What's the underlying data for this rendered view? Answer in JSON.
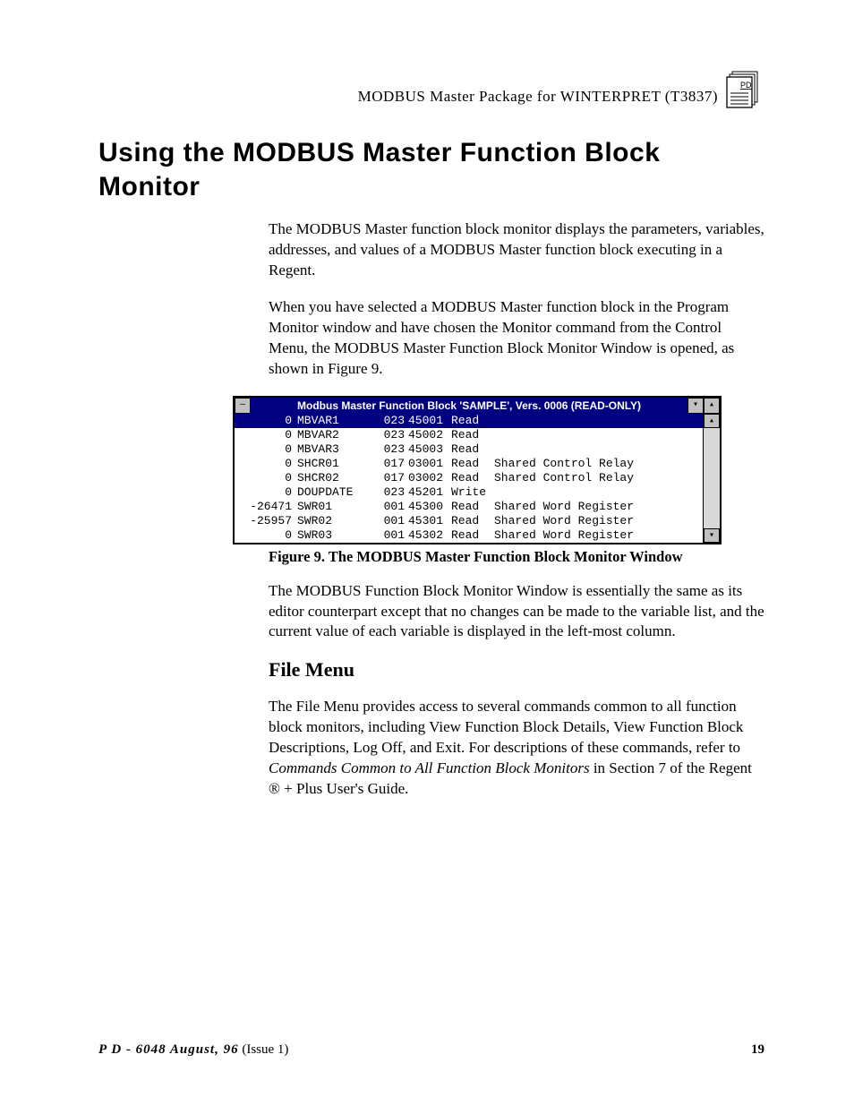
{
  "header": {
    "text": "MODBUS  Master  Package  for  WINTERPRET  (T3837)",
    "icon_label": "PD"
  },
  "title": "Using the MODBUS Master Function Block Monitor",
  "para1": "The MODBUS Master function block monitor displays the parameters, variables, addresses, and values of a MODBUS Master function block executing in a Regent.",
  "para2": "When you have selected a MODBUS Master function block in the Program Monitor window and have chosen the Monitor command from the Control Menu, the MODBUS Master Function Block Monitor Window is opened, as shown in Figure 9.",
  "window": {
    "title": "Modbus Master Function Block 'SAMPLE', Vers. 0006 (READ-ONLY)",
    "rows": [
      {
        "val": "0",
        "name": "MBVAR1",
        "s": "023",
        "addr": "45001",
        "rw": "Read",
        "desc": "",
        "sel": true
      },
      {
        "val": "0",
        "name": "MBVAR2",
        "s": "023",
        "addr": "45002",
        "rw": "Read",
        "desc": ""
      },
      {
        "val": "0",
        "name": "MBVAR3",
        "s": "023",
        "addr": "45003",
        "rw": "Read",
        "desc": ""
      },
      {
        "val": "0",
        "name": "SHCR01",
        "s": "017",
        "addr": "03001",
        "rw": "Read",
        "desc": "Shared Control Relay"
      },
      {
        "val": "0",
        "name": "SHCR02",
        "s": "017",
        "addr": "03002",
        "rw": "Read",
        "desc": "Shared Control Relay"
      },
      {
        "val": "0",
        "name": "DOUPDATE",
        "s": "023",
        "addr": "45201",
        "rw": "Write",
        "desc": ""
      },
      {
        "val": "-26471",
        "name": "SWR01",
        "s": "001",
        "addr": "45300",
        "rw": "Read",
        "desc": "Shared Word Register"
      },
      {
        "val": "-25957",
        "name": "SWR02",
        "s": "001",
        "addr": "45301",
        "rw": "Read",
        "desc": "Shared Word Register"
      },
      {
        "val": "0",
        "name": "SWR03",
        "s": "001",
        "addr": "45302",
        "rw": "Read",
        "desc": "Shared Word Register"
      }
    ]
  },
  "caption": "Figure 9. The MODBUS Master Function Block Monitor Window",
  "para3": "The MODBUS Function Block Monitor Window is essentially the same as its editor counterpart except that no changes can be made to the variable list, and the current value of each variable is displayed in the left-most column.",
  "subhead": "File Menu",
  "para4a": "The File Menu provides access to several commands common to all function block monitors, including View Function Block Details, View Function Block Descriptions, Log Off, and Exit. For descriptions of these commands, refer to ",
  "para4b": "Commands Common to All Function Block Monitors",
  "para4c": " in Section 7 of the Regent ® + Plus User's Guide.",
  "footer": {
    "left_a": "P D - 6048   August,   96",
    "left_b": "   (Issue 1)",
    "right": "19"
  }
}
